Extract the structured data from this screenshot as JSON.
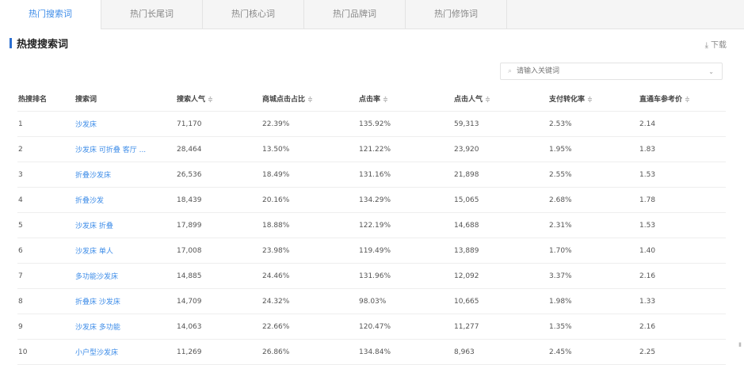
{
  "tabs": [
    {
      "label": "热门搜索词",
      "active": true
    },
    {
      "label": "热门长尾词",
      "active": false
    },
    {
      "label": "热门核心词",
      "active": false
    },
    {
      "label": "热门品牌词",
      "active": false
    },
    {
      "label": "热门修饰词",
      "active": false
    }
  ],
  "section": {
    "title": "热搜搜索词"
  },
  "download": {
    "label": "下载",
    "icon": "download-icon"
  },
  "search": {
    "placeholder": "请输入关键词",
    "value": "",
    "icon": "search-icon",
    "caret_icon": "chevron-down-icon"
  },
  "table": {
    "columns": [
      {
        "label": "热搜排名",
        "sortable": false
      },
      {
        "label": "搜索词",
        "sortable": false
      },
      {
        "label": "搜索人气",
        "sortable": true
      },
      {
        "label": "商城点击占比",
        "sortable": true
      },
      {
        "label": "点击率",
        "sortable": true
      },
      {
        "label": "点击人气",
        "sortable": true
      },
      {
        "label": "支付转化率",
        "sortable": true
      },
      {
        "label": "直通车参考价",
        "sortable": true
      }
    ],
    "sort_glyph": "≑",
    "rows": [
      [
        "1",
        "沙发床",
        "71,170",
        "22.39%",
        "135.92%",
        "59,313",
        "2.53%",
        "2.14"
      ],
      [
        "2",
        "沙发床 可折叠 客厅 ...",
        "28,464",
        "13.50%",
        "121.22%",
        "23,920",
        "1.95%",
        "1.83"
      ],
      [
        "3",
        "折叠沙发床",
        "26,536",
        "18.49%",
        "131.16%",
        "21,898",
        "2.55%",
        "1.53"
      ],
      [
        "4",
        "折叠沙发",
        "18,439",
        "20.16%",
        "134.29%",
        "15,065",
        "2.68%",
        "1.78"
      ],
      [
        "5",
        "沙发床 折叠",
        "17,899",
        "18.88%",
        "122.19%",
        "14,688",
        "2.31%",
        "1.53"
      ],
      [
        "6",
        "沙发床 单人",
        "17,008",
        "23.98%",
        "119.49%",
        "13,889",
        "1.70%",
        "1.40"
      ],
      [
        "7",
        "多功能沙发床",
        "14,885",
        "24.46%",
        "131.96%",
        "12,092",
        "3.37%",
        "2.16"
      ],
      [
        "8",
        "折叠床 沙发床",
        "14,709",
        "24.32%",
        "98.03%",
        "10,665",
        "1.98%",
        "1.33"
      ],
      [
        "9",
        "沙发床 多功能",
        "14,063",
        "22.66%",
        "120.47%",
        "11,277",
        "1.35%",
        "2.16"
      ],
      [
        "10",
        "小户型沙发床",
        "11,269",
        "26.86%",
        "134.84%",
        "8,963",
        "2.45%",
        "2.25"
      ]
    ]
  }
}
